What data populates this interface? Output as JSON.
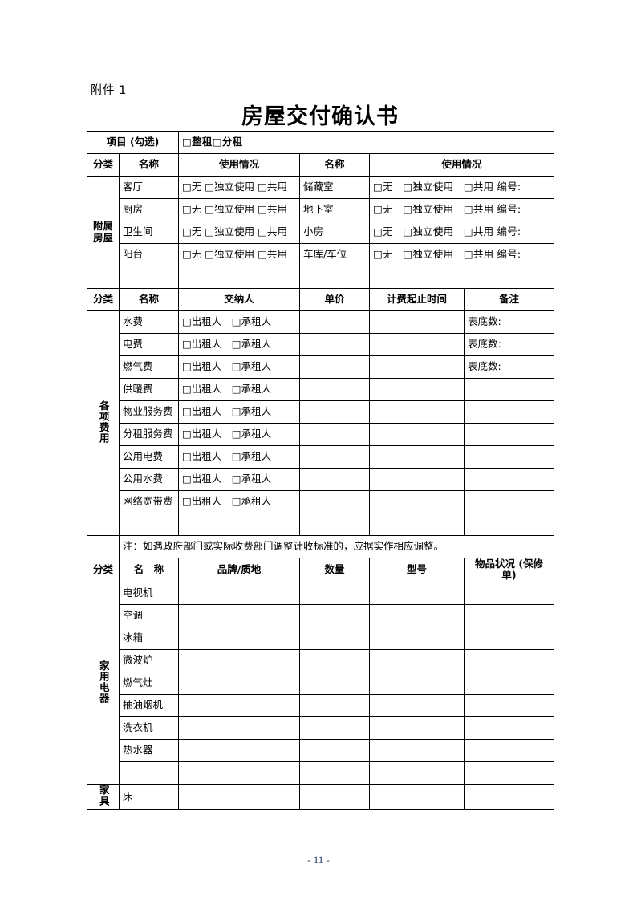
{
  "document": {
    "attachment_label": "附件 1",
    "title": "房屋交付确认书",
    "page_number": "- 11 -",
    "page_number_color": "#17365d"
  },
  "project_row": {
    "label": "项目（勾选）",
    "label_display": "项目 (勾选)",
    "value": "□整租□分租",
    "options": [
      "整租",
      "分租"
    ],
    "checkbox_glyph": "□"
  },
  "section_rooms": {
    "category_label": "附属房屋",
    "category_label_lines": [
      "附属",
      "房屋"
    ],
    "headers": [
      "分类",
      "名称",
      "使用情况",
      "名称",
      "使用情况"
    ],
    "rows": [
      {
        "left_name": "客厅",
        "left_usage": "□无 □独立使用 □共用",
        "right_name": "储藏室",
        "right_usage": "□无　□独立使用　□共用 编号:"
      },
      {
        "left_name": "厨房",
        "left_usage": "□无 □独立使用 □共用",
        "right_name": "地下室",
        "right_usage": "□无　□独立使用　□共用 编号:"
      },
      {
        "left_name": "卫生间",
        "left_usage": "□无 □独立使用 □共用",
        "right_name": "小房",
        "right_usage": "□无　□独立使用　□共用 编号:"
      },
      {
        "left_name": "阳台",
        "left_usage": "□无 □独立使用 □共用",
        "right_name": "车库/车位",
        "right_usage": "□无　□独立使用　□共用 编号:"
      },
      {
        "left_name": "",
        "left_usage": "",
        "right_name": "",
        "right_usage": ""
      }
    ],
    "usage_options": [
      "无",
      "独立使用",
      "共用"
    ],
    "number_label": "编号:"
  },
  "section_fees": {
    "category_label": "各项费用",
    "headers": [
      "分类",
      "名称",
      "交纳人",
      "单价",
      "计费起止时间",
      "备注"
    ],
    "payer_options": [
      "出租人",
      "承租人"
    ],
    "payer_cell": "□出租人　□承租人",
    "rows": [
      {
        "name": "水费",
        "payer": "□出租人　□承租人",
        "unit_price": "",
        "billing_period": "",
        "remark": "表底数:"
      },
      {
        "name": "电费",
        "payer": "□出租人　□承租人",
        "unit_price": "",
        "billing_period": "",
        "remark": "表底数:"
      },
      {
        "name": "燃气费",
        "payer": "□出租人　□承租人",
        "unit_price": "",
        "billing_period": "",
        "remark": "表底数:"
      },
      {
        "name": "供暖费",
        "payer": "□出租人　□承租人",
        "unit_price": "",
        "billing_period": "",
        "remark": ""
      },
      {
        "name": "物业服务费",
        "payer": "□出租人　□承租人",
        "unit_price": "",
        "billing_period": "",
        "remark": ""
      },
      {
        "name": "分租服务费",
        "payer": "□出租人　□承租人",
        "unit_price": "",
        "billing_period": "",
        "remark": ""
      },
      {
        "name": "公用电费",
        "payer": "□出租人　□承租人",
        "unit_price": "",
        "billing_period": "",
        "remark": ""
      },
      {
        "name": "公用水费",
        "payer": "□出租人　□承租人",
        "unit_price": "",
        "billing_period": "",
        "remark": ""
      },
      {
        "name": "网络宽带费",
        "payer": "□出租人　□承租人",
        "unit_price": "",
        "billing_period": "",
        "remark": ""
      },
      {
        "name": "",
        "payer": "",
        "unit_price": "",
        "billing_period": "",
        "remark": ""
      }
    ],
    "note": "注：如遇政府部门或实际收费部门调整计收标准的，应据实作相应调整。"
  },
  "section_items": {
    "headers": [
      "分类",
      "名 称",
      "品牌/质地",
      "数量",
      "型号",
      "物品状况（保修单）"
    ],
    "headers_display": [
      "分类",
      "名　称",
      "品牌/质地",
      "数量",
      "型号",
      "物品状况 (保修单)"
    ],
    "appliances": {
      "category_label": "家用电器",
      "rows": [
        {
          "name": "电视机",
          "brand": "",
          "quantity": "",
          "model": "",
          "condition": ""
        },
        {
          "name": "空调",
          "brand": "",
          "quantity": "",
          "model": "",
          "condition": ""
        },
        {
          "name": "冰箱",
          "brand": "",
          "quantity": "",
          "model": "",
          "condition": ""
        },
        {
          "name": "微波炉",
          "brand": "",
          "quantity": "",
          "model": "",
          "condition": ""
        },
        {
          "name": "燃气灶",
          "brand": "",
          "quantity": "",
          "model": "",
          "condition": ""
        },
        {
          "name": "抽油烟机",
          "brand": "",
          "quantity": "",
          "model": "",
          "condition": ""
        },
        {
          "name": "洗衣机",
          "brand": "",
          "quantity": "",
          "model": "",
          "condition": ""
        },
        {
          "name": "热水器",
          "brand": "",
          "quantity": "",
          "model": "",
          "condition": ""
        },
        {
          "name": "",
          "brand": "",
          "quantity": "",
          "model": "",
          "condition": ""
        }
      ]
    },
    "furniture": {
      "category_label": "家具",
      "rows": [
        {
          "name": "床",
          "brand": "",
          "quantity": "",
          "model": "",
          "condition": ""
        }
      ]
    }
  }
}
